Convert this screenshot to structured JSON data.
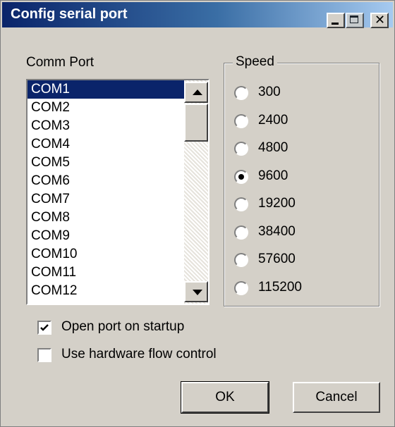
{
  "window": {
    "title": "Config serial port",
    "controls": [
      "minimize-icon",
      "maximize-icon",
      "close-icon"
    ]
  },
  "comm_port": {
    "label": "Comm Port",
    "items": [
      "COM1",
      "COM2",
      "COM3",
      "COM4",
      "COM5",
      "COM6",
      "COM7",
      "COM8",
      "COM9",
      "COM10",
      "COM11",
      "COM12"
    ],
    "selected": "COM1"
  },
  "speed": {
    "label": "Speed",
    "options": [
      "300",
      "2400",
      "4800",
      "9600",
      "19200",
      "38400",
      "57600",
      "115200"
    ],
    "selected": "9600"
  },
  "options": {
    "open_on_startup": {
      "label": "Open port on startup",
      "checked": true
    },
    "hw_flow_control": {
      "label": "Use hardware flow control",
      "checked": false
    }
  },
  "buttons": {
    "ok": "OK",
    "cancel": "Cancel"
  },
  "colors": {
    "title_bar": "#0a246a",
    "selection": "#0a246a",
    "dialog_bg": "#d4d0c8"
  }
}
